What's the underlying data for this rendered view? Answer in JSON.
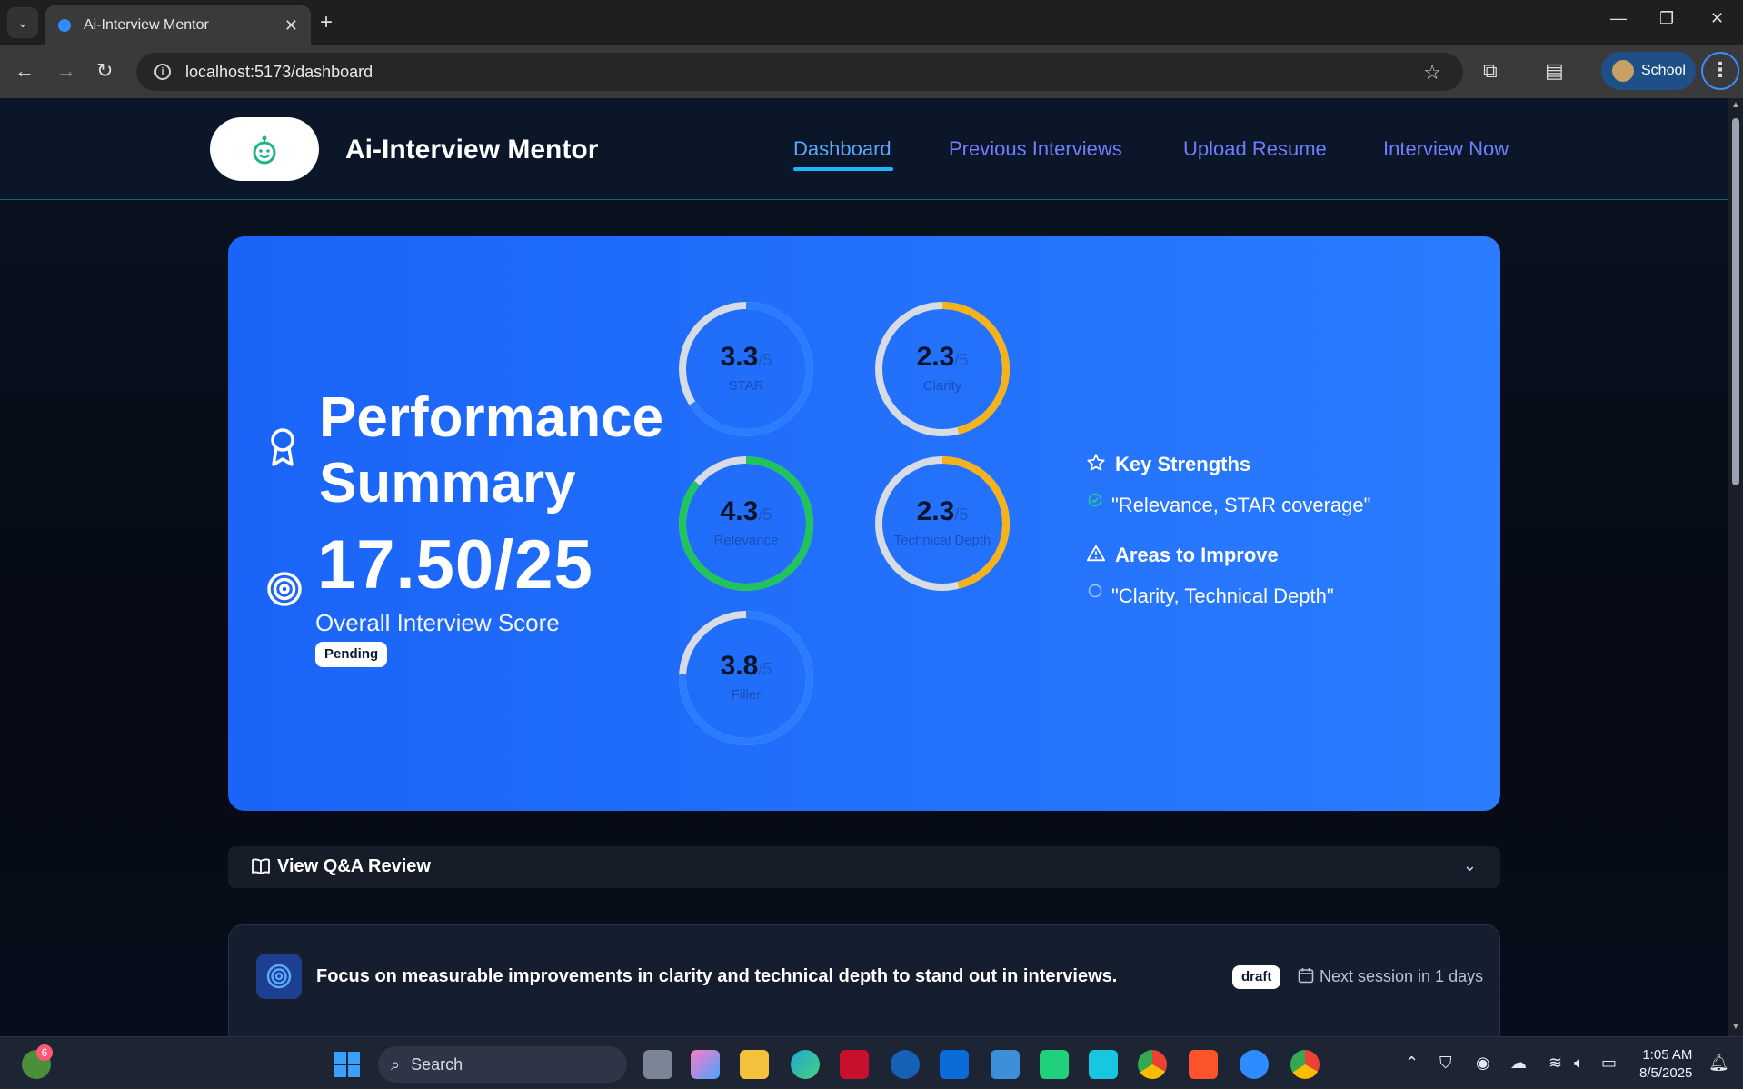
{
  "browser": {
    "tab_title": "Ai-Interview Mentor",
    "url": "localhost:5173/dashboard",
    "profile_label": "School"
  },
  "header": {
    "brand": "Ai-Interview Mentor",
    "nav": [
      "Dashboard",
      "Previous Interviews",
      "Upload Resume",
      "Interview Now"
    ],
    "active_nav": "Dashboard"
  },
  "summary": {
    "title": "Performance Summary",
    "score": "17.50/25",
    "score_label": "Overall Interview Score",
    "status": "Pending"
  },
  "metrics": [
    {
      "value": "3.3",
      "max": "/5",
      "label": "STAR",
      "fraction": 0.66,
      "color": "#2b7cff"
    },
    {
      "value": "2.3",
      "max": "/5",
      "label": "Clarity",
      "fraction": 0.46,
      "color": "#f5b21a"
    },
    {
      "value": "4.3",
      "max": "/5",
      "label": "Relevance",
      "fraction": 0.86,
      "color": "#1fc45a"
    },
    {
      "value": "2.3",
      "max": "/5",
      "label": "Technical Depth",
      "fraction": 0.46,
      "color": "#f5b21a"
    },
    {
      "value": "3.8",
      "max": "/5",
      "label": "Filler",
      "fraction": 0.76,
      "color": "#2b7cff"
    }
  ],
  "strengths": {
    "heading": "Key Strengths",
    "items": [
      "\"Relevance, STAR coverage\""
    ]
  },
  "improve": {
    "heading": "Areas to Improve",
    "items": [
      "\"Clarity, Technical Depth\""
    ]
  },
  "qa": {
    "label": "View Q&A Review"
  },
  "focus": {
    "text": "Focus on measurable improvements in clarity and technical depth to stand out in interviews.",
    "badge": "draft",
    "next": "Next session in 1 days"
  },
  "taskbar": {
    "search": "Search",
    "notification_count": "6",
    "time": "1:05 AM",
    "date": "8/5/2025"
  },
  "colors": {
    "hero": "#1f6bff",
    "nav": "#6f7dff",
    "accent": "#22b3ff"
  }
}
